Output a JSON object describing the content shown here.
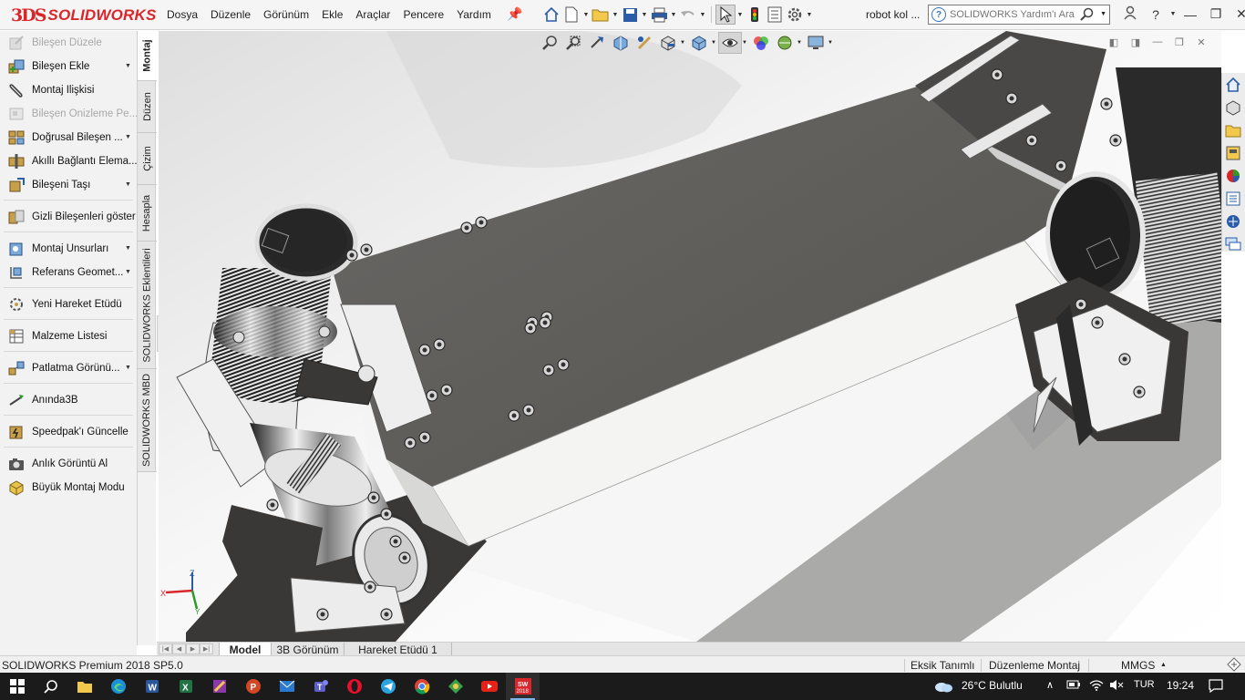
{
  "app": {
    "logo_prefix": "3DS",
    "logo_text": "SOLIDWORKS",
    "menu": [
      "Dosya",
      "Düzenle",
      "Görünüm",
      "Ekle",
      "Araçlar",
      "Pencere",
      "Yardım"
    ],
    "document_title": "robot kol ...",
    "search_placeholder": "SOLIDWORKS Yardım'ı Ara"
  },
  "command_manager": {
    "items": [
      {
        "label": "Bileşen Düzele",
        "icon": "edit-component-icon",
        "enabled": false,
        "dropdown": false
      },
      {
        "label": "Bileşen Ekle",
        "icon": "insert-component-icon",
        "enabled": true,
        "dropdown": true
      },
      {
        "label": "Montaj İlişkisi",
        "icon": "mate-paperclip-icon",
        "enabled": true,
        "dropdown": false
      },
      {
        "label": "Bileşen Önizleme Pe...",
        "icon": "component-preview-icon",
        "enabled": false,
        "dropdown": false
      },
      {
        "label": "Doğrusal Bileşen ...",
        "icon": "linear-pattern-icon",
        "enabled": true,
        "dropdown": true
      },
      {
        "label": "Akıllı Bağlantı Elema...",
        "icon": "smart-fasteners-icon",
        "enabled": true,
        "dropdown": false
      },
      {
        "label": "Bileşeni Taşı",
        "icon": "move-component-icon",
        "enabled": true,
        "dropdown": true
      },
      {
        "label": "Gizli Bileşenleri göster",
        "icon": "show-hidden-icon",
        "enabled": true,
        "dropdown": false
      },
      {
        "label": "Montaj Unsurları",
        "icon": "assembly-features-icon",
        "enabled": true,
        "dropdown": true
      },
      {
        "label": "Referans Geomet...",
        "icon": "reference-geometry-icon",
        "enabled": true,
        "dropdown": true
      },
      {
        "label": "Yeni Hareket Etüdü",
        "icon": "motion-study-icon",
        "enabled": true,
        "dropdown": false
      },
      {
        "label": "Malzeme Listesi",
        "icon": "bill-of-materials-icon",
        "enabled": true,
        "dropdown": false
      },
      {
        "label": "Patlatma Görünü...",
        "icon": "exploded-view-icon",
        "enabled": true,
        "dropdown": true
      },
      {
        "label": "Anında3B",
        "icon": "instant3d-icon",
        "enabled": true,
        "dropdown": false
      },
      {
        "label": "Speedpak'ı Güncelle",
        "icon": "speedpak-icon",
        "enabled": true,
        "dropdown": false
      },
      {
        "label": "Anlık Görüntü Al",
        "icon": "snapshot-camera-icon",
        "enabled": true,
        "dropdown": false
      },
      {
        "label": "Büyük Montaj Modu",
        "icon": "large-assembly-icon",
        "enabled": true,
        "dropdown": false
      }
    ],
    "vertical_tabs": [
      "Montaj",
      "Düzen",
      "Çizim",
      "Hesapla",
      "SOLIDWORKS Eklentileri",
      "SOLIDWORKS MBD"
    ]
  },
  "document_tabs": [
    "Model",
    "3B Görünüm",
    "Hareket Etüdü 1"
  ],
  "status_bar": {
    "product": "SOLIDWORKS Premium 2018 SP5.0",
    "definition": "Eksik Tanımlı",
    "mode": "Düzenleme Montaj",
    "units": "MMGS"
  },
  "triad": {
    "x": "X",
    "y": "Y",
    "z": "Z"
  },
  "taskbar": {
    "weather": "26°C  Bulutlu",
    "language": "TUR",
    "time": "19:24",
    "sw_badge": "2018"
  },
  "colors": {
    "brand_red": "#d9262b",
    "accent_blue": "#2b6bd3",
    "taskbar_bg": "#1b1b1b"
  }
}
